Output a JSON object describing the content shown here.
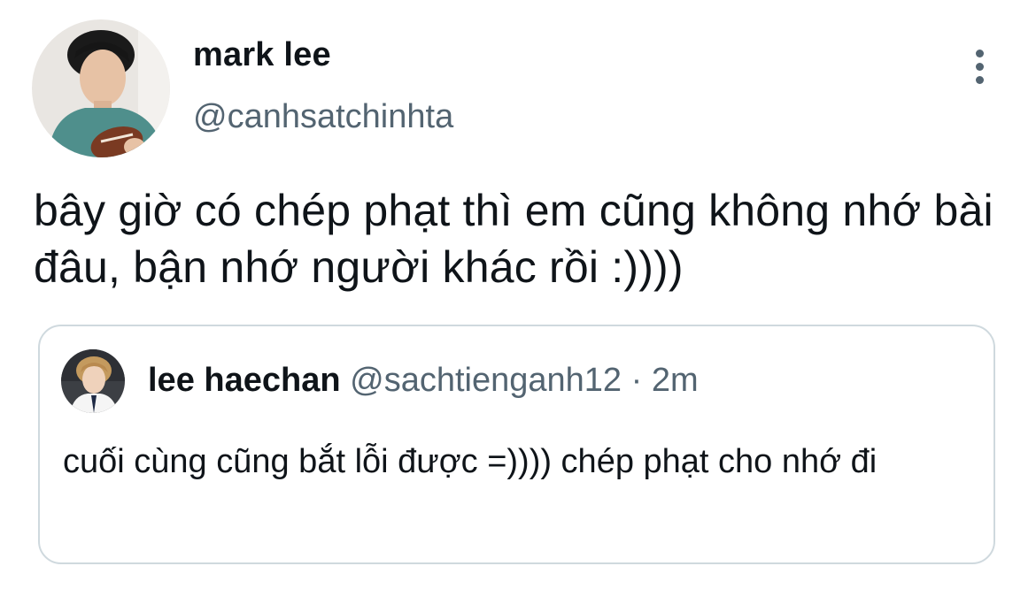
{
  "tweet": {
    "author": {
      "display_name": "mark lee",
      "handle": "@canhsatchinhta",
      "avatar_icon": "profile-photo"
    },
    "text": "bây giờ có chép phạt thì em cũng không nhớ bài đâu, bận nhớ người khác rồi :))))",
    "more_icon": "more-vertical-icon"
  },
  "quoted_tweet": {
    "author": {
      "display_name": "lee haechan",
      "handle": "@sachtienganh12",
      "avatar_icon": "profile-photo"
    },
    "separator": "·",
    "time": "2m",
    "text": "cuối cùng cũng bắt lỗi được =)))) chép phạt cho nhớ đi"
  },
  "colors": {
    "primary_text": "#0f1419",
    "secondary_text": "#536471",
    "border": "#cfd9de",
    "background": "#ffffff"
  }
}
